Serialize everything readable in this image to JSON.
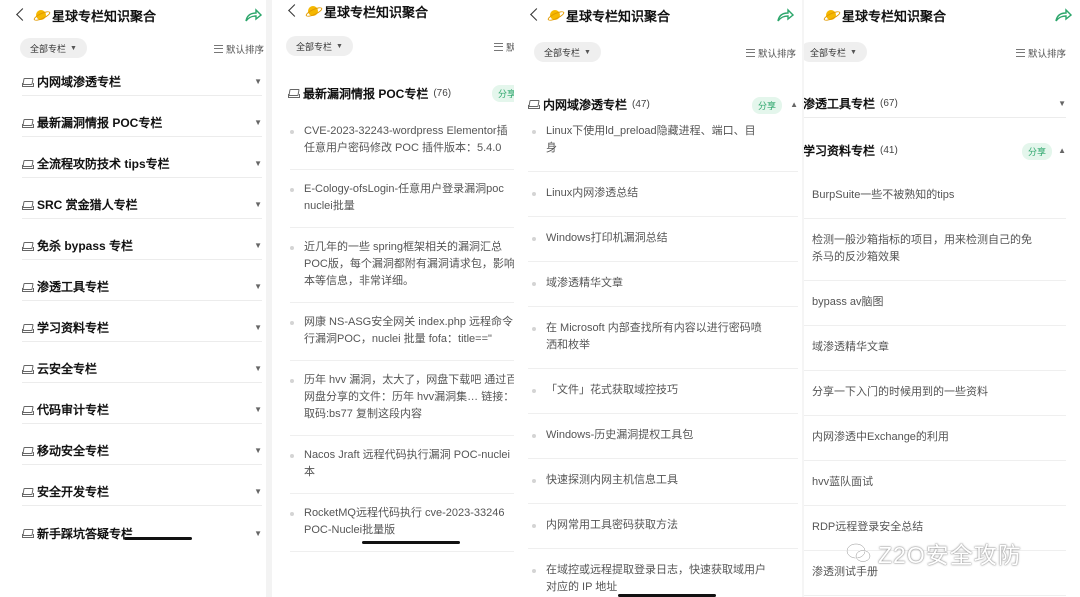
{
  "header": {
    "title": "星球专栏知识聚合"
  },
  "toolbar": {
    "filter_label": "全部专栏",
    "sort_label": "默认排序"
  },
  "badge": {
    "share": "分享"
  },
  "panel1": {
    "columns": [
      {
        "label": "内网域渗透专栏"
      },
      {
        "label": "最新漏洞情报 POC专栏"
      },
      {
        "label": "全流程攻防技术 tips专栏"
      },
      {
        "label": "SRC 赏金猎人专栏"
      },
      {
        "label": "免杀 bypass 专栏"
      },
      {
        "label": "渗透工具专栏"
      },
      {
        "label": "学习资料专栏"
      },
      {
        "label": "云安全专栏"
      },
      {
        "label": "代码审计专栏"
      },
      {
        "label": "移动安全专栏"
      },
      {
        "label": "安全开发专栏"
      },
      {
        "label": "新手踩坑答疑专栏"
      }
    ]
  },
  "panel2": {
    "column": {
      "label": "最新漏洞情报 POC专栏",
      "count": "(76)"
    },
    "articles": [
      [
        "CVE-2023-32243-wordpress Elementor插",
        "任意用户密码修改 POC 插件版本：5.4.0"
      ],
      [
        "E-Cology-ofsLogin-任意用户登录漏洞poc",
        "nuclei批量"
      ],
      [
        "近几年的一些 spring框架相关的漏洞汇总",
        "POC版，每个漏洞都附有漏洞请求包，影响",
        "本等信息，非常详细。"
      ],
      [
        "网康 NS-ASG安全网关 index.php 远程命令",
        "行漏洞POC，nuclei 批量  fofa：title==\""
      ],
      [
        "历年 hvv 漏洞，太大了，网盘下载吧 通过百",
        "网盘分享的文件：历年 hvv漏洞集… 链接：",
        "取码:bs77 复制这段内容"
      ],
      [
        "Nacos Jraft 远程代码执行漏洞 POC-nuclei",
        "本"
      ],
      [
        "RocketMQ远程代码执行 cve-2023-33246",
        "POC-Nuclei批量版"
      ]
    ]
  },
  "panel3": {
    "column": {
      "label": "内网域渗透专栏",
      "count": "(47)"
    },
    "articles": [
      [
        "Linux下使用ld_preload隐藏进程、端口、目",
        "身"
      ],
      [
        "Linux内网渗透总结"
      ],
      [
        "Windows打印机漏洞总结"
      ],
      [
        "域渗透精华文章"
      ],
      [
        "在 Microsoft 内部查找所有内容以进行密码喷",
        "洒和枚举"
      ],
      [
        "「文件」花式获取域控技巧"
      ],
      [
        "Windows-历史漏洞提权工具包"
      ],
      [
        "快速探测内网主机信息工具"
      ],
      [
        "内网常用工具密码获取方法"
      ],
      [
        "在域控或远程提取登录日志，快速获取域用户",
        "对应的 IP 地址"
      ]
    ]
  },
  "panel4": {
    "columns": [
      {
        "label": "渗透工具专栏",
        "count": "(67)"
      },
      {
        "label": "学习资料专栏",
        "count": "(41)"
      }
    ],
    "articles": [
      [
        "BurpSuite一些不被熟知的tips"
      ],
      [
        "检测一般沙箱指标的项目，用来检测自己的免",
        "杀马的反沙箱效果"
      ],
      [
        "bypass av脑图"
      ],
      [
        "域渗透精华文章"
      ],
      [
        "分享一下入门的时候用到的一些资料"
      ],
      [
        "内网渗透中Exchange的利用"
      ],
      [
        "hvv蓝队面试"
      ],
      [
        "RDP远程登录安全总结"
      ],
      [
        "渗透测试手册"
      ]
    ]
  },
  "watermark": {
    "text": "Z2O安全攻防"
  },
  "icons": [
    "back-arrow-icon",
    "planet-icon",
    "share-arrow-icon",
    "column-stack-icon",
    "sort-icon",
    "caret-down-icon",
    "caret-up-icon",
    "wechat-icon"
  ],
  "colors": {
    "accent": "#2ca66b",
    "badge_bg": "#e4f6ec",
    "planet": "#f5b800"
  }
}
